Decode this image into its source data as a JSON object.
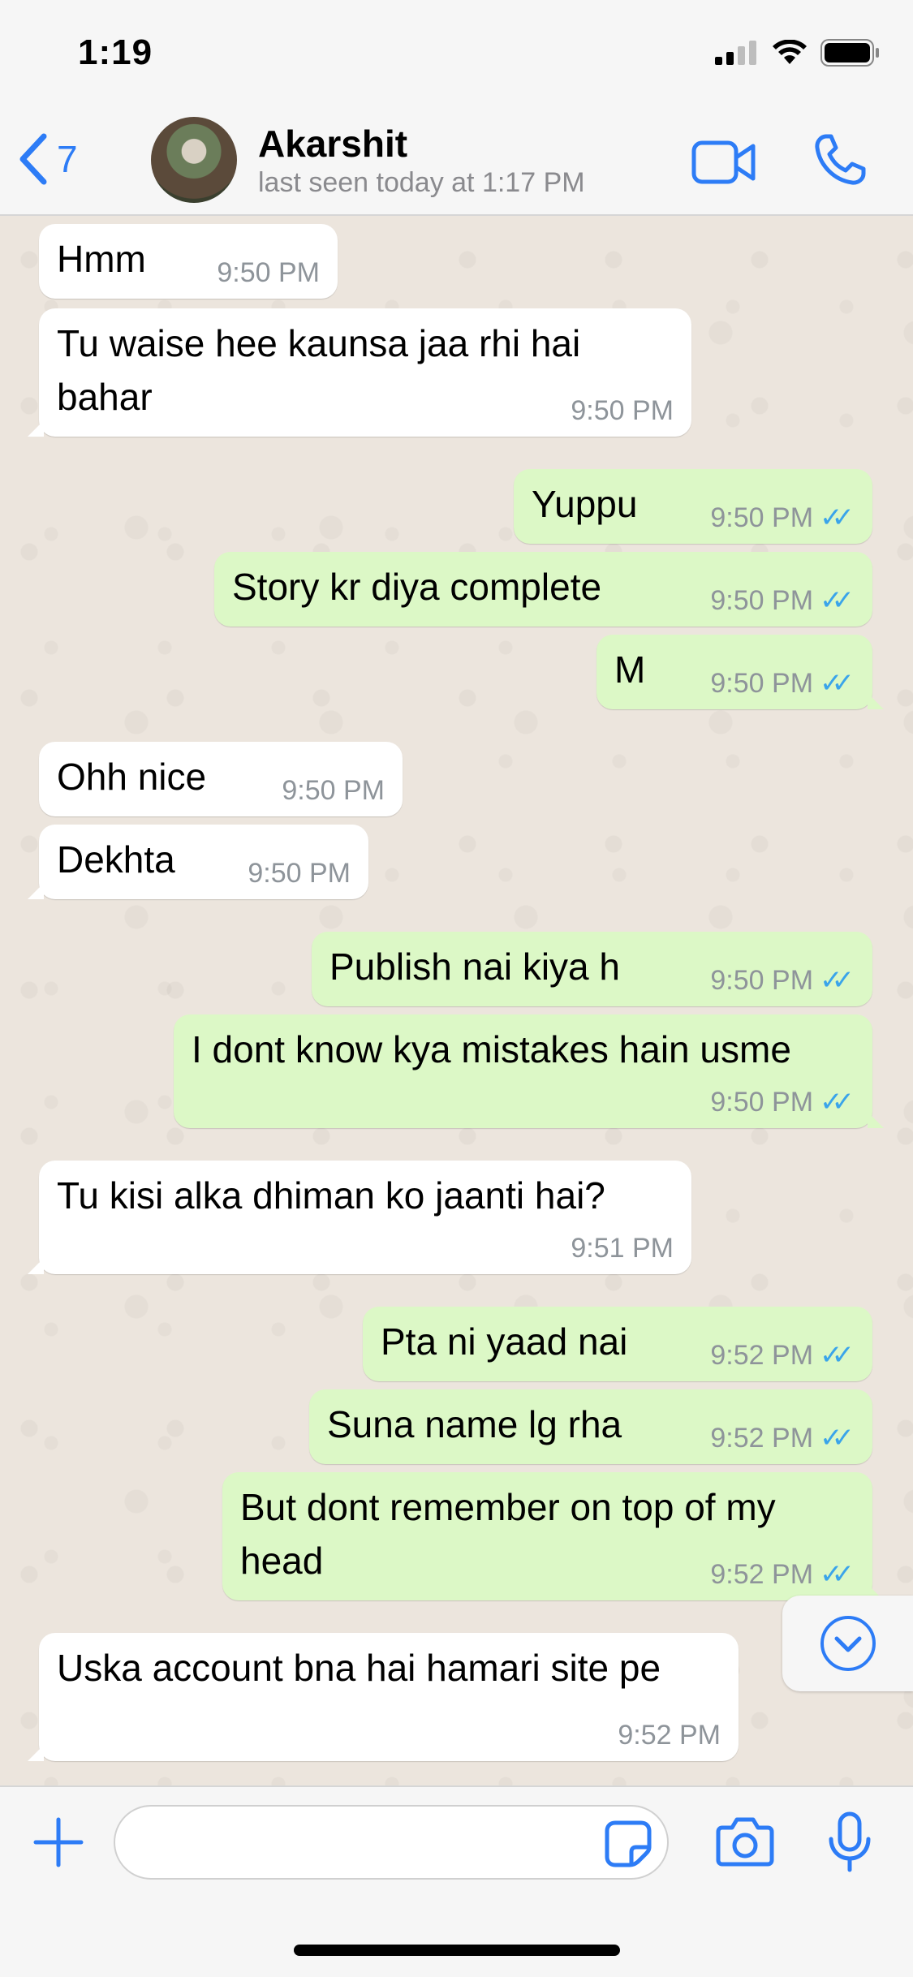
{
  "status_bar": {
    "time": "1:19"
  },
  "header": {
    "back_count": "7",
    "contact_name": "Akarshit",
    "contact_status": "last seen today at 1:17 PM"
  },
  "colors": {
    "accent": "#2d7cf6",
    "incoming_bubble": "#ffffff",
    "outgoing_bubble": "#dcf8c6",
    "read_ticks": "#3aa4ea"
  },
  "messages": [
    {
      "direction": "in",
      "text": "Hmm",
      "time": "9:50 PM"
    },
    {
      "direction": "in",
      "text": "Tu waise hee kaunsa jaa rhi hai bahar",
      "time": "9:50 PM"
    },
    {
      "direction": "out",
      "text": "Yuppu",
      "time": "9:50 PM",
      "status": "read"
    },
    {
      "direction": "out",
      "text": "Story kr diya complete",
      "time": "9:50 PM",
      "status": "read"
    },
    {
      "direction": "out",
      "text": "M",
      "time": "9:50 PM",
      "status": "read"
    },
    {
      "direction": "in",
      "text": "Ohh nice",
      "time": "9:50 PM"
    },
    {
      "direction": "in",
      "text": "Dekhta",
      "time": "9:50 PM"
    },
    {
      "direction": "out",
      "text": "Publish nai kiya h",
      "time": "9:50 PM",
      "status": "read"
    },
    {
      "direction": "out",
      "text": "I dont know kya mistakes hain usme",
      "time": "9:50 PM",
      "status": "read"
    },
    {
      "direction": "in",
      "text": "Tu kisi alka dhiman ko jaanti hai?",
      "time": "9:51 PM"
    },
    {
      "direction": "out",
      "text": "Pta ni yaad nai",
      "time": "9:52 PM",
      "status": "read"
    },
    {
      "direction": "out",
      "text": "Suna name lg rha",
      "time": "9:52 PM",
      "status": "read"
    },
    {
      "direction": "out",
      "text": "But dont remember on top of my head",
      "time": "9:52 PM",
      "status": "read"
    },
    {
      "direction": "in",
      "text": "Uska account bna hai hamari site pe",
      "time": "9:52 PM"
    }
  ],
  "composer": {
    "value": "",
    "placeholder": ""
  },
  "icons": [
    "signal-icon",
    "wifi-icon",
    "battery-icon",
    "back-chevron-icon",
    "video-call-icon",
    "phone-icon",
    "scroll-down-icon",
    "plus-icon",
    "sticker-icon",
    "camera-icon",
    "microphone-icon"
  ]
}
